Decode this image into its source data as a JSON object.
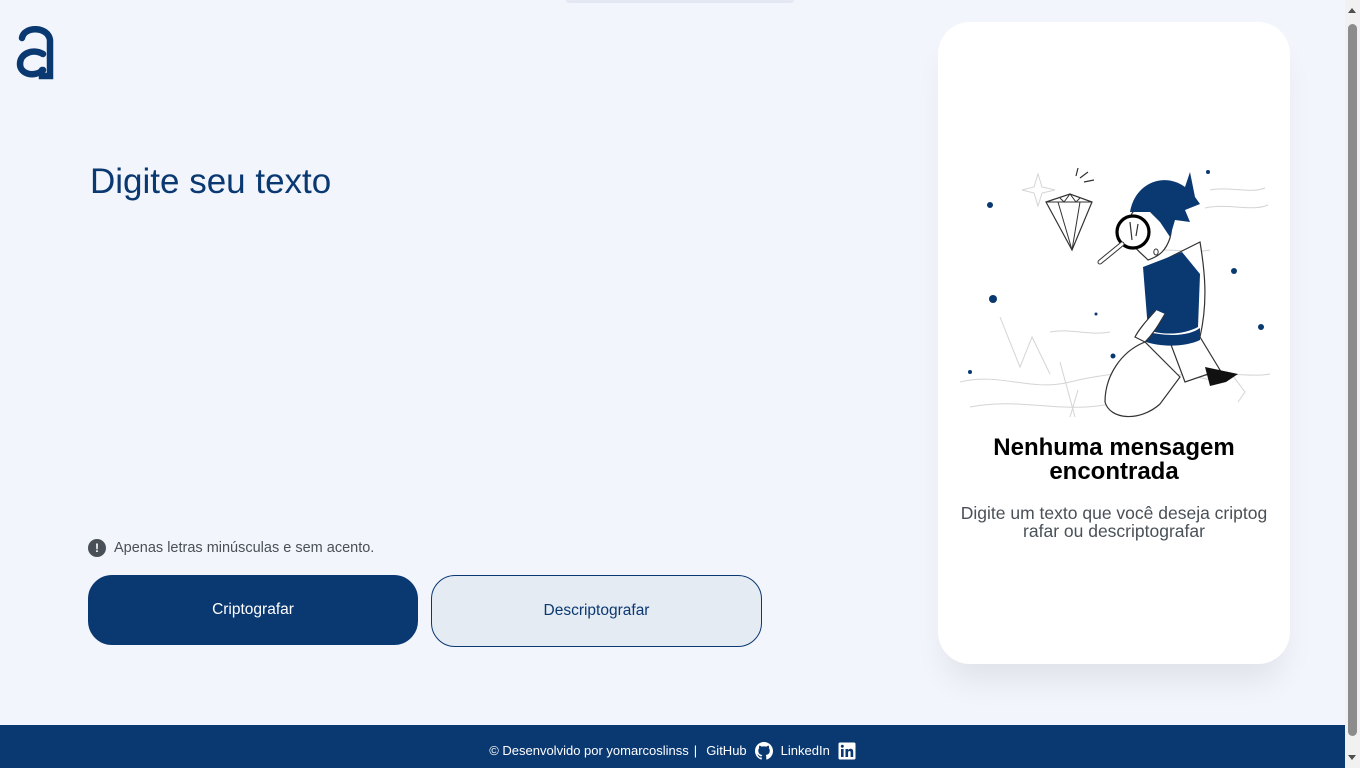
{
  "header": {
    "logo": "alura-logo"
  },
  "editor": {
    "placeholder": "Digite seu texto"
  },
  "hint": {
    "icon": "exclamation-circle-icon",
    "text": "Apenas letras minúsculas e sem acento."
  },
  "buttons": {
    "encrypt_label": "Criptografar",
    "decrypt_label": "Descriptografar"
  },
  "result": {
    "illustration": "magnifier-boy-diamond-illustration",
    "title": "Nenhuma mensagem encontrada",
    "description": "Digite um texto que você deseja criptografar ou descriptografar"
  },
  "footer": {
    "credit": "© Desenvolvido por yomarcoslinss",
    "separator": "|",
    "github_label": "GitHub",
    "linkedin_label": "LinkedIn"
  },
  "colors": {
    "primary": "#0a3871",
    "background": "#f3f5fc",
    "secondary_button": "#e5ebf3"
  }
}
